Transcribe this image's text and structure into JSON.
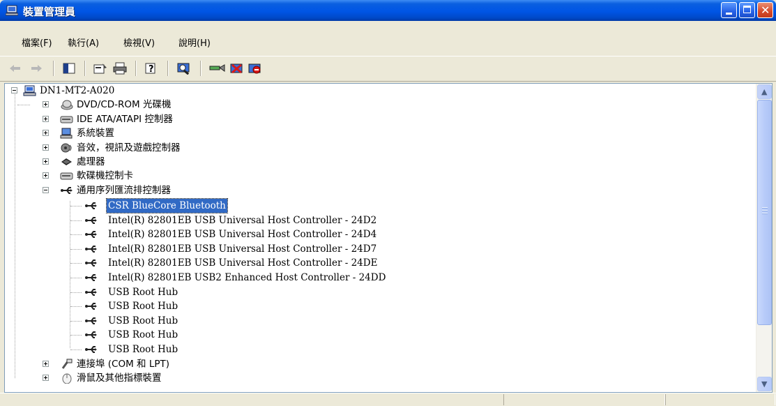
{
  "window": {
    "title": "裝置管理員"
  },
  "menu": [
    "檔案(F)",
    "執行(A)",
    "檢視(V)",
    "說明(H)"
  ],
  "toolbar": {
    "buttons": [
      "back-icon",
      "forward-icon",
      "show-hide-tree-icon",
      "properties-icon",
      "print-icon",
      "help-icon",
      "scan-hardware-icon",
      "update-driver-icon",
      "uninstall-icon",
      "disable-icon"
    ]
  },
  "tree": {
    "root": "DN1-MT2-A020",
    "categories": [
      {
        "label": "DVD/CD-ROM 光碟機",
        "icon": "cdrom-icon"
      },
      {
        "label": "IDE ATA/ATAPI 控制器",
        "icon": "ide-controller-icon"
      },
      {
        "label": "系統裝置",
        "icon": "system-device-icon"
      },
      {
        "label": "音效，視訊及遊戲控制器",
        "icon": "sound-icon"
      },
      {
        "label": "處理器",
        "icon": "processor-icon"
      },
      {
        "label": "軟碟機控制卡",
        "icon": "floppy-controller-icon"
      },
      {
        "label": "通用序列匯流排控制器",
        "icon": "usb-icon"
      }
    ],
    "usb_children": [
      "CSR BlueCore Bluetooth",
      "Intel(R) 82801EB USB Universal Host Controller - 24D2",
      "Intel(R) 82801EB USB Universal Host Controller - 24D4",
      "Intel(R) 82801EB USB Universal Host Controller - 24D7",
      "Intel(R) 82801EB USB Universal Host Controller - 24DE",
      "Intel(R) 82801EB USB2 Enhanced Host Controller - 24DD",
      "USB Root Hub",
      "USB Root Hub",
      "USB Root Hub",
      "USB Root Hub",
      "USB Root Hub"
    ],
    "after": [
      {
        "label": "連接埠 (COM 和 LPT)",
        "icon": "port-icon"
      },
      {
        "label": "滑鼠及其他指標裝置",
        "icon": "mouse-icon"
      }
    ],
    "selected_index": 0
  },
  "colors": {
    "selection": "#316ac5",
    "titlebar": "#0055e5"
  }
}
